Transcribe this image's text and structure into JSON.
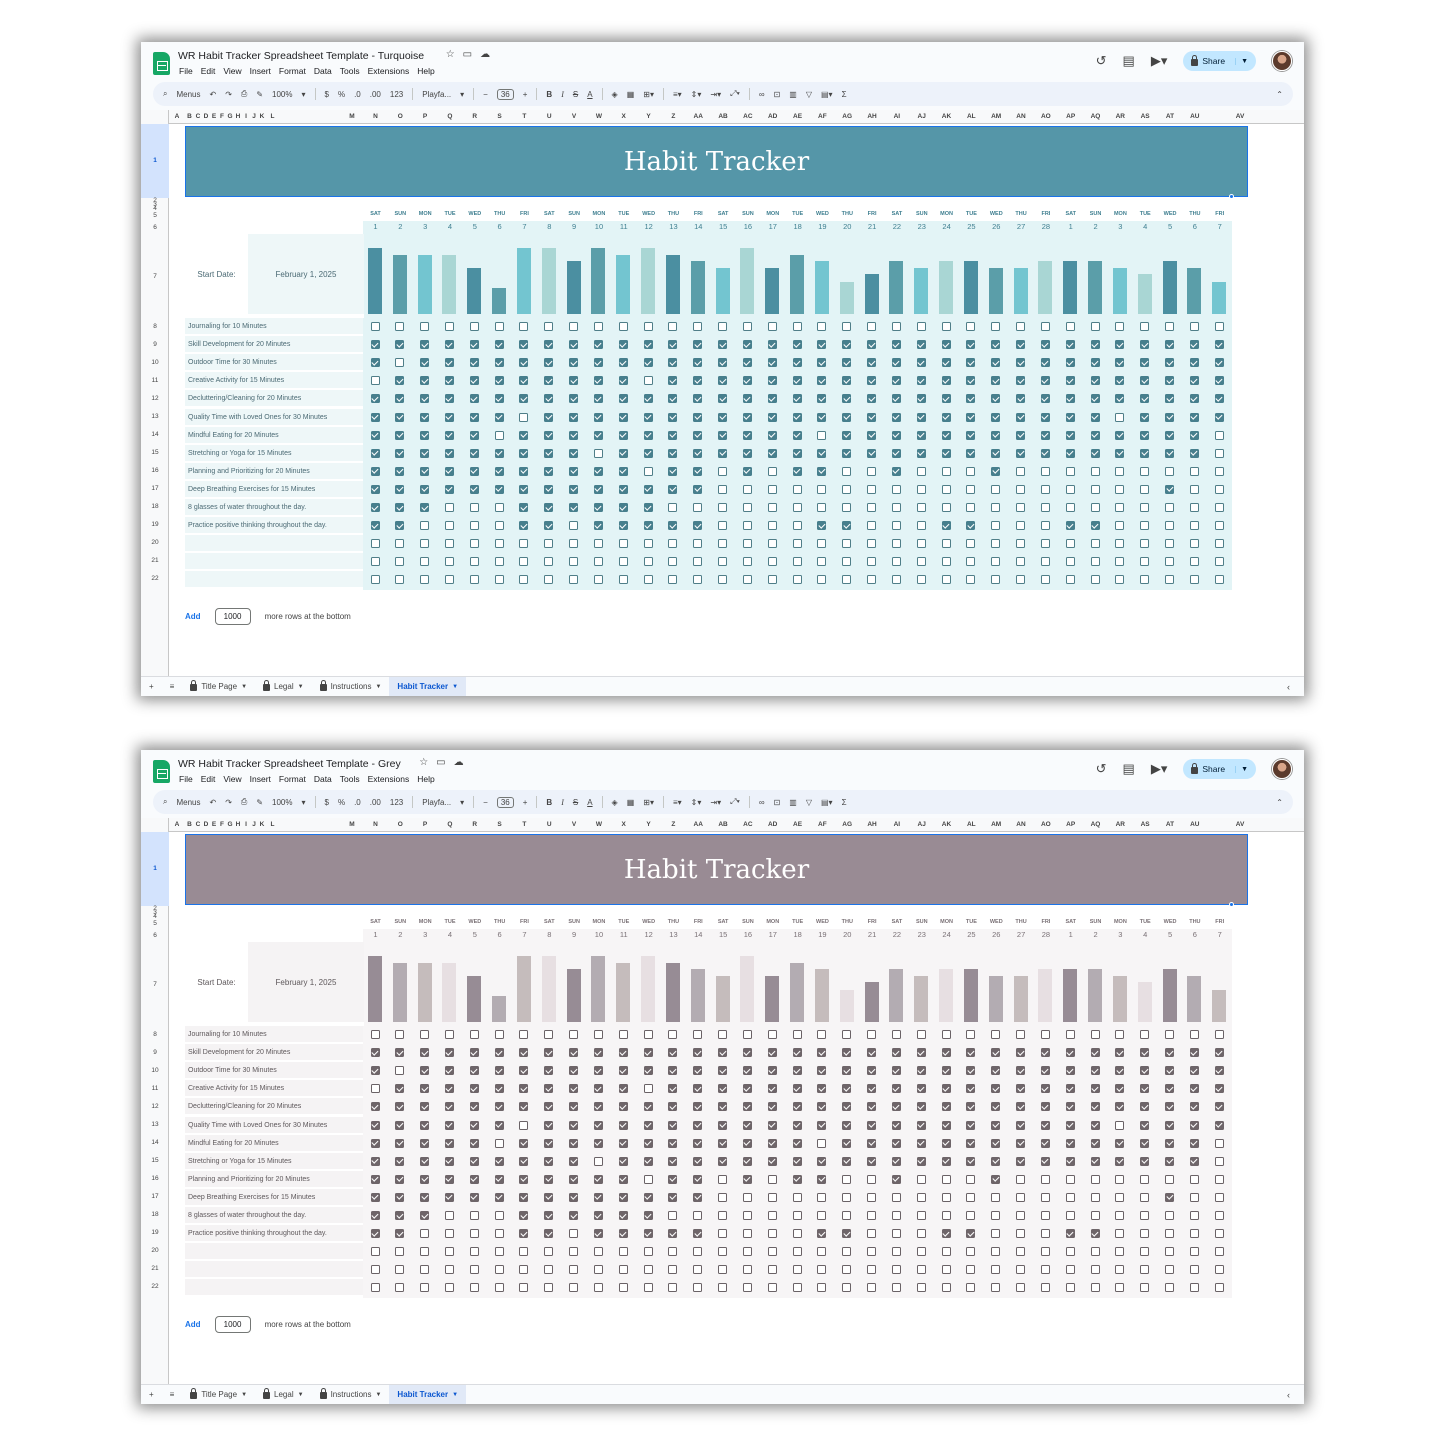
{
  "app": {
    "menu_items": [
      "File",
      "Edit",
      "View",
      "Insert",
      "Format",
      "Data",
      "Tools",
      "Extensions",
      "Help"
    ],
    "share_label": "Share",
    "toolbar": {
      "search_label": "Menus",
      "zoom": "100%",
      "currency": "$",
      "percent": "%",
      "decrease_decimals": ".0",
      "increase_decimals": ".00",
      "number_format": "123",
      "font": "Playfa...",
      "font_size": "36",
      "bold": "B",
      "italic": "I",
      "strike": "S",
      "text_color": "A",
      "functions": "Σ"
    },
    "add_label": "Add",
    "add_rows_value": "1000",
    "add_rows_text": "more rows at the bottom",
    "tabs": [
      "Title Page",
      "Legal",
      "Instructions",
      "Habit Tracker"
    ],
    "active_tab": "Habit Tracker"
  },
  "columns": [
    "A",
    "B",
    "C",
    "D",
    "E",
    "F",
    "G",
    "H",
    "I",
    "J",
    "K",
    "L",
    "M",
    "N",
    "O",
    "P",
    "Q",
    "R",
    "S",
    "T",
    "U",
    "V",
    "W",
    "X",
    "Y",
    "Z",
    "AA",
    "AB",
    "AC",
    "AD",
    "AE",
    "AF",
    "AG",
    "AH",
    "AI",
    "AJ",
    "AK",
    "AL",
    "AM",
    "AN",
    "AO",
    "AP",
    "AQ",
    "AR",
    "AS",
    "AT",
    "AU",
    "AV"
  ],
  "rows": [
    "1",
    "2",
    "3",
    "4",
    "5",
    "6",
    "7",
    "8",
    "9",
    "10",
    "11",
    "12",
    "13",
    "14",
    "15",
    "16",
    "17",
    "18",
    "19",
    "20",
    "21",
    "22"
  ],
  "tracker": {
    "banner_title": "Habit Tracker",
    "start_date_label": "Start Date:",
    "start_date": "February 1, 2025",
    "days": [
      "SAT",
      "SUN",
      "MON",
      "TUE",
      "WED",
      "THU",
      "FRI",
      "SAT",
      "SUN",
      "MON",
      "TUE",
      "WED",
      "THU",
      "FRI",
      "SAT",
      "SUN",
      "MON",
      "TUE",
      "WED",
      "THU",
      "FRI",
      "SAT",
      "SUN",
      "MON",
      "TUE",
      "WED",
      "THU",
      "FRI",
      "SAT",
      "SUN",
      "MON",
      "TUE",
      "WED",
      "THU",
      "FRI"
    ],
    "dates": [
      "1",
      "2",
      "3",
      "4",
      "5",
      "6",
      "7",
      "8",
      "9",
      "10",
      "11",
      "12",
      "13",
      "14",
      "15",
      "16",
      "17",
      "18",
      "19",
      "20",
      "21",
      "22",
      "23",
      "24",
      "25",
      "26",
      "27",
      "28",
      "1",
      "2",
      "3",
      "4",
      "5",
      "6",
      "7"
    ],
    "completion_levels": [
      0.92,
      0.82,
      0.82,
      0.82,
      0.64,
      0.36,
      0.92,
      0.92,
      0.73,
      0.92,
      0.82,
      0.92,
      0.82,
      0.73,
      0.64,
      0.92,
      0.64,
      0.82,
      0.73,
      0.45,
      0.55,
      0.73,
      0.64,
      0.73,
      0.73,
      0.64,
      0.64,
      0.73,
      0.73,
      0.73,
      0.64,
      0.55,
      0.73,
      0.64,
      0.45
    ],
    "habits": [
      "Journaling for 10 Minutes",
      "Skill Development for 20 Minutes",
      "Outdoor Time for 30 Minutes",
      "Creative Activity for 15 Minutes",
      "Decluttering/Cleaning for 20 Minutes",
      "Quality Time with Loved Ones for 30 Minutes",
      "Mindful Eating for 20 Minutes",
      "Stretching or Yoga for 15 Minutes",
      "Planning and Prioritizing for 20 Minutes",
      "Deep Breathing Exercises for 15 Minutes",
      "8 glasses of water throughout the day.",
      "Practice positive thinking throughout the day.",
      "",
      "",
      ""
    ],
    "checks": [
      "00000000000000000000000000000000000",
      "11111111111111111111111111111111111",
      "10111111111111111111111111111111111",
      "01111111111011111111111111111111111",
      "11111111111111111111111111111111111",
      "11111101111111111111111111111101111",
      "11111011111111111101111111111111110",
      "11111111101111111111111111111111110",
      "11111111111011010110010001000000000",
      "11111111111111000000000000000000100",
      "11100011111100000000000000000000000",
      "11000011011111000011000110001100000",
      "00000000000000000000000000000000000",
      "00000000000000000000000000000000000",
      "00000000000000000000000000000000000"
    ]
  },
  "windows": [
    {
      "title": "WR Habit Tracker Spreadsheet Template - Turquoise",
      "theme": {
        "banner": "#5596a8",
        "panel": "#e3f4f6",
        "label_bg": "#eef7f8",
        "label_text": "#4b6a74",
        "day_text": "#3f7f90",
        "num_text": "#3f7f90",
        "check_on": "#477f8d",
        "check_off_border": "#4f7e88",
        "bar_colors": [
          "#4b8fa1",
          "#5b9ea9",
          "#73c5d0",
          "#a9d6d4"
        ]
      }
    },
    {
      "title": "WR Habit Tracker Spreadsheet Template - Grey",
      "theme": {
        "banner": "#998b94",
        "panel": "#f7f5f6",
        "label_bg": "#f5f3f4",
        "label_text": "#5e585b",
        "day_text": "#7a7176",
        "num_text": "#7a7176",
        "check_on": "#6e6569",
        "check_off_border": "#6a6266",
        "bar_colors": [
          "#978c95",
          "#b3acb2",
          "#c5bcbc",
          "#e7dfe2"
        ]
      }
    }
  ]
}
